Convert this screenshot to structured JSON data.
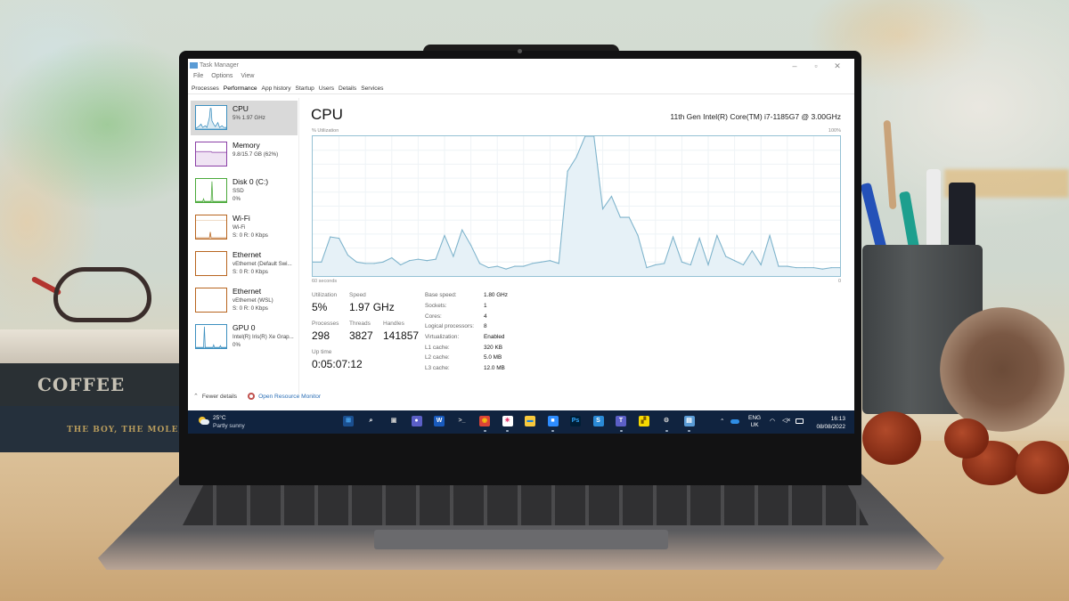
{
  "window": {
    "title": "Task Manager",
    "controls": {
      "minimize": "–",
      "maximize": "▫",
      "close": "✕"
    }
  },
  "menu": [
    "File",
    "Options",
    "View"
  ],
  "tabs": [
    {
      "label": "Processes",
      "active": false
    },
    {
      "label": "Performance",
      "active": true
    },
    {
      "label": "App history",
      "active": false
    },
    {
      "label": "Startup",
      "active": false
    },
    {
      "label": "Users",
      "active": false
    },
    {
      "label": "Details",
      "active": false
    },
    {
      "label": "Services",
      "active": false
    }
  ],
  "sidebar": {
    "items": [
      {
        "title": "CPU",
        "lines": [
          "5% 1.97 GHz"
        ],
        "color": "#3c8fbf",
        "selected": true
      },
      {
        "title": "Memory",
        "lines": [
          "9.8/15.7 GB (62%)"
        ],
        "color": "#8b3fa6",
        "selected": false
      },
      {
        "title": "Disk 0 (C:)",
        "lines": [
          "SSD",
          "0%"
        ],
        "color": "#4aa93a",
        "selected": false
      },
      {
        "title": "Wi-Fi",
        "lines": [
          "Wi-Fi",
          "S: 0 R: 0 Kbps"
        ],
        "color": "#b8651f",
        "selected": false
      },
      {
        "title": "Ethernet",
        "lines": [
          "vEthernet (Default Swi...",
          "S: 0 R: 0 Kbps"
        ],
        "color": "#b8651f",
        "selected": false
      },
      {
        "title": "Ethernet",
        "lines": [
          "vEthernet (WSL)",
          "S: 0 R: 0 Kbps"
        ],
        "color": "#b8651f",
        "selected": false
      },
      {
        "title": "GPU 0",
        "lines": [
          "Intel(R) Iris(R) Xe Grap...",
          "0%"
        ],
        "color": "#3c8fbf",
        "selected": false
      }
    ]
  },
  "main": {
    "title": "CPU",
    "cpu_model": "11th Gen Intel(R) Core(TM) i7-1185G7 @ 3.00GHz",
    "graph_label_top_left": "% Utilization",
    "graph_label_top_right": "100%",
    "graph_label_bottom_left": "60 seconds",
    "graph_label_bottom_right": "0",
    "stats": {
      "utilization_label": "Utilization",
      "utilization": "5%",
      "speed_label": "Speed",
      "speed": "1.97 GHz",
      "processes_label": "Processes",
      "processes": "298",
      "threads_label": "Threads",
      "threads": "3827",
      "handles_label": "Handles",
      "handles": "141857",
      "uptime_label": "Up time",
      "uptime": "0:05:07:12"
    },
    "specs": [
      {
        "label": "Base speed:",
        "value": "1.80 GHz"
      },
      {
        "label": "Sockets:",
        "value": "1"
      },
      {
        "label": "Cores:",
        "value": "4"
      },
      {
        "label": "Logical processors:",
        "value": "8"
      },
      {
        "label": "Virtualization:",
        "value": "Enabled"
      },
      {
        "label": "L1 cache:",
        "value": "320 KB"
      },
      {
        "label": "L2 cache:",
        "value": "5.0 MB"
      },
      {
        "label": "L3 cache:",
        "value": "12.0 MB"
      }
    ]
  },
  "footer": {
    "fewer_details": "Fewer details",
    "open_resource_monitor": "Open Resource Monitor"
  },
  "chart_data": {
    "type": "area",
    "title": "CPU % Utilization",
    "xlabel": "60 seconds",
    "ylabel": "% Utilization",
    "ylim": [
      0,
      100
    ],
    "xlim": [
      60,
      0
    ],
    "grid": true,
    "color": "#7fb4cc",
    "fill": "#e6f1f7",
    "x": [
      60,
      59,
      58,
      57,
      56,
      55,
      54,
      53,
      52,
      51,
      50,
      49,
      48,
      47,
      46,
      45,
      44,
      43,
      42,
      41,
      40,
      39,
      38,
      37,
      36,
      35,
      34,
      33,
      32,
      31,
      30,
      29,
      28,
      27,
      26,
      25,
      24,
      23,
      22,
      21,
      20,
      19,
      18,
      17,
      16,
      15,
      14,
      13,
      12,
      11,
      10,
      9,
      8,
      7,
      6,
      5,
      4,
      3,
      2,
      1,
      0
    ],
    "values": [
      10,
      10,
      28,
      27,
      15,
      10,
      9,
      9,
      10,
      13,
      8,
      11,
      12,
      11,
      12,
      29,
      14,
      33,
      22,
      9,
      6,
      7,
      5,
      7,
      7,
      9,
      10,
      11,
      9,
      75,
      85,
      100,
      100,
      48,
      57,
      42,
      42,
      29,
      6,
      8,
      9,
      28,
      10,
      8,
      27,
      8,
      29,
      14,
      11,
      8,
      18,
      8,
      29,
      7,
      7,
      6,
      6,
      6,
      5,
      6,
      6
    ]
  },
  "taskbar": {
    "weather_temp": "25°C",
    "weather_condition": "Partly sunny",
    "apps": [
      {
        "name": "start",
        "glyph": "⊞",
        "bg": "#1b4f8f",
        "fg": "#4fb3ff"
      },
      {
        "name": "search",
        "glyph": "⌕",
        "bg": "transparent",
        "fg": "#ffffff"
      },
      {
        "name": "task-view",
        "glyph": "▣",
        "bg": "transparent",
        "fg": "#c9c9c9"
      },
      {
        "name": "teams-chat",
        "glyph": "●",
        "bg": "#5b5fc7",
        "fg": "#ffffff"
      },
      {
        "name": "word",
        "glyph": "W",
        "bg": "#185abd",
        "fg": "#ffffff"
      },
      {
        "name": "terminal",
        "glyph": ">_",
        "bg": "transparent",
        "fg": "#cccccc"
      },
      {
        "name": "chrome",
        "glyph": "◉",
        "bg": "#db4437",
        "fg": "#f4c20d"
      },
      {
        "name": "slack",
        "glyph": "✳",
        "bg": "#ffffff",
        "fg": "#e01e5a"
      },
      {
        "name": "file-explorer",
        "glyph": "▬",
        "bg": "#f8c93d",
        "fg": "#1c7fd6"
      },
      {
        "name": "zoom",
        "glyph": "■",
        "bg": "#2d8cff",
        "fg": "#ffffff"
      },
      {
        "name": "photoshop",
        "glyph": "Ps",
        "bg": "#001e36",
        "fg": "#31a8ff"
      },
      {
        "name": "snagit",
        "glyph": "S",
        "bg": "#2a8ad6",
        "fg": "#ffffff"
      },
      {
        "name": "teams",
        "glyph": "T",
        "bg": "#5b5fc7",
        "fg": "#ffffff"
      },
      {
        "name": "sticky-notes",
        "glyph": "▞",
        "bg": "#f7d900",
        "fg": "#7a5b00"
      },
      {
        "name": "settings",
        "glyph": "⚙",
        "bg": "transparent",
        "fg": "#d0d0d0"
      },
      {
        "name": "task-manager",
        "glyph": "▤",
        "bg": "#5a9bd5",
        "fg": "#ffffff"
      }
    ],
    "tray": {
      "chevron": "⌃",
      "language_line1": "ENG",
      "language_line2": "UK",
      "wifi": "📶",
      "volume": "🔇",
      "battery": "▭"
    },
    "time": "16:13",
    "date": "08/08/2022"
  }
}
